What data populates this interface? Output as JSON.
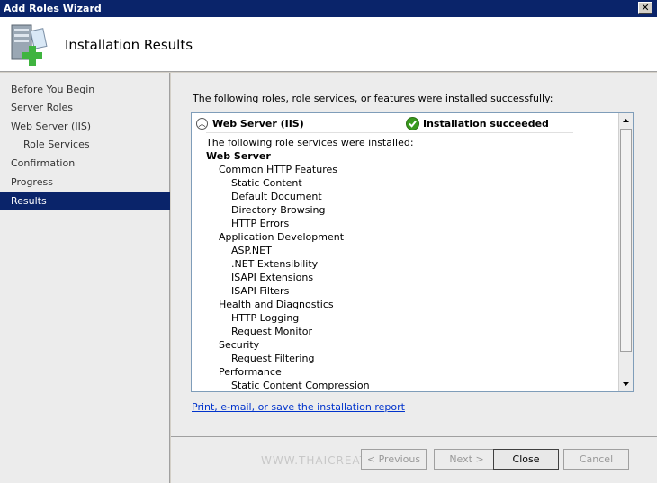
{
  "window": {
    "title": "Add Roles Wizard"
  },
  "header": {
    "title": "Installation Results"
  },
  "nav": {
    "items": [
      {
        "label": "Before You Begin"
      },
      {
        "label": "Server Roles"
      },
      {
        "label": "Web Server (IIS)"
      },
      {
        "label": "Role Services"
      },
      {
        "label": "Confirmation"
      },
      {
        "label": "Progress"
      },
      {
        "label": "Results"
      }
    ]
  },
  "main": {
    "intro": "The following roles, role services, or features were installed successfully:",
    "result": {
      "role": "Web Server (IIS)",
      "status": "Installation succeeded",
      "lines": [
        "The following role services were installed:",
        "Web Server",
        "Common HTTP Features",
        "Static Content",
        "Default Document",
        "Directory Browsing",
        "HTTP Errors",
        "Application Development",
        "ASP.NET",
        ".NET Extensibility",
        "ISAPI Extensions",
        "ISAPI Filters",
        "Health and Diagnostics",
        "HTTP Logging",
        "Request Monitor",
        "Security",
        "Request Filtering",
        "Performance",
        "Static Content Compression"
      ]
    },
    "report_link": "Print, e-mail, or save the installation report"
  },
  "footer": {
    "watermark": "WWW.THAICREATE.COM",
    "previous_label": "< Previous",
    "next_label": "Next >",
    "close_label": "Close",
    "cancel_label": "Cancel"
  },
  "colors": {
    "accent": "#0a246a",
    "link": "#0033cc",
    "success": "#3a9a1e"
  }
}
